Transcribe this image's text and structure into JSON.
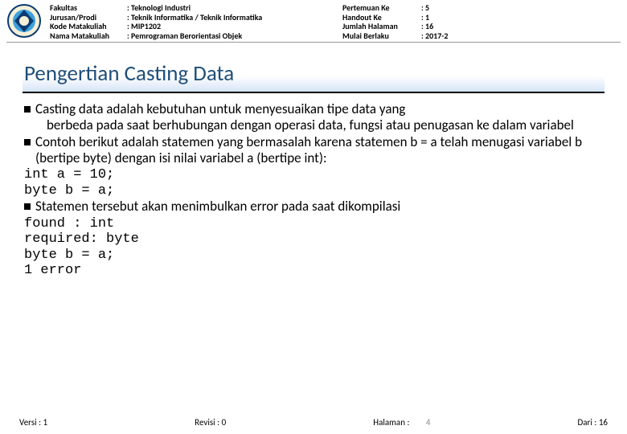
{
  "header": {
    "labels1": {
      "fakultas": "Fakultas",
      "jurusan": "Jurusan/Prodi",
      "kode": "Kode Matakuliah",
      "nama": "Nama Matakuliah"
    },
    "values1": {
      "fakultas": ": Teknologi Industri",
      "jurusan": ": Teknik Informatika / Teknik Informatika",
      "kode": ": MIP1202",
      "nama": ": Pemrograman Berorientasi Objek"
    },
    "labels2": {
      "pertemuan": "Pertemuan Ke",
      "handout": "Handout Ke",
      "jumlah": "Jumlah Halaman",
      "mulai": "Mulai Berlaku"
    },
    "values2": {
      "pertemuan": ": 5",
      "handout": ": 1",
      "jumlah": ": 16",
      "mulai": ": 2017-2"
    }
  },
  "title": "Pengertian Casting Data",
  "content": {
    "b1": "Casting data adalah kebutuhan untuk menyesuaikan tipe data yang",
    "b1c": "berbeda pada saat berhubungan dengan operasi data, fungsi atau penugasan ke dalam variabel",
    "b2": "Contoh berikut adalah statemen yang bermasalah karena statemen b = a telah menugasi variabel b (bertipe byte) dengan isi nilai variabel a (bertipe int):",
    "code1": "int a = 10;\nbyte b = a;",
    "b3": "Statemen tersebut akan menimbulkan error pada saat dikompilasi",
    "code2": "found : int\nrequired: byte\nbyte b = a;\n1 error"
  },
  "footer": {
    "versi": "Versi : 1",
    "revisi": "Revisi : 0",
    "halaman_label": "Halaman :",
    "halaman_num": "4",
    "dari": "Dari : 16"
  }
}
